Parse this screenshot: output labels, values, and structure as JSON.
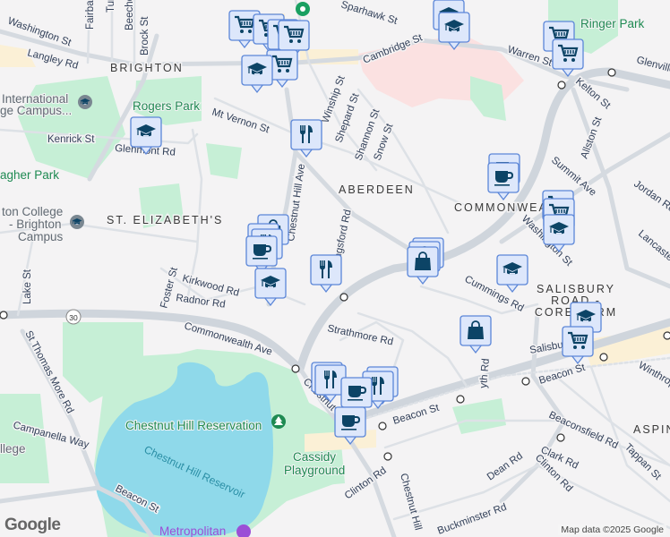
{
  "neighborhoods": {
    "brighton": "BRIGHTON",
    "aberdeen": "ABERDEEN",
    "st_elizabeths": "ST. ELIZABETH'S",
    "commonwealth": "COMMONWEA",
    "salisbury1": "SALISBURY",
    "salisbury2": "ROAD -",
    "salisbury3": "CORE FARM",
    "aspin": "ASPIN"
  },
  "parks": {
    "rogers": "Rogers Park",
    "ringer": "Ringer Park",
    "gallagher": "agher Park",
    "reservation": "Chestnut Hill Reservation",
    "cassidy1": "Cassidy",
    "cassidy2": "Playground",
    "reservoir": "Chestnut Hill Reservoir"
  },
  "pois": {
    "intl1": "International",
    "intl2": "ge Campus...",
    "bc1": "ton College",
    "bc2": "- Brighton",
    "bc3": "Campus",
    "college": "llege",
    "metropolitan": "Metropolitan"
  },
  "streets": {
    "washington": "Washington St",
    "langley": "Langley Rd",
    "fairbanks": "Fairban",
    "tur": "Tur",
    "beechcroft": "Beechc",
    "brock": "Brock St",
    "sparhawk": "Sparhawk St",
    "cambridge": "Cambridge St",
    "warren": "Warren St",
    "kelton": "Kelton St",
    "glenville": "Glenville",
    "mtvernon": "Mt Vernon St",
    "kenrick": "Kenrick St",
    "glenmont": "Glenmont Rd",
    "winship": "Winship St",
    "shepard": "Shepard St",
    "shannon": "Shannon St",
    "snow": "Snow St",
    "chestnut_hill_ave": "Chestnut Hill Ave",
    "allston": "Allston St",
    "summit": "Summit Ave",
    "jordan": "Jordan Rd",
    "lancaster": "Lancaster",
    "washington2": "Washington St",
    "kingsford": "Kingsford Rd",
    "kirkwood": "Kirkwood Rd",
    "radnor": "Radnor Rd",
    "foster": "Foster St",
    "lake": "Lake St",
    "commonwealth": "Commonwealth Ave",
    "st_thomas_more": "St Thomas More Rd",
    "campanella": "Campanella Way",
    "beacon1": "Beacon St",
    "beacon2": "Beacon St",
    "beacon3": "Beacon St",
    "cummings": "Cummings Rd",
    "strathmore": "Strathmore Rd",
    "ayth": "yth Rd",
    "salisbury": "Salisbu",
    "beaconsfield": "Beaconsfield Rd",
    "clark": "Clark Rd",
    "clinton1": "Clinton Rd",
    "clinton2": "Clinton Rd",
    "dean": "Dean Rd",
    "tappan": "Tappan St",
    "winthrop": "Winthrop",
    "buckminster": "Buckminster Rd",
    "chestnut_hill_ave2": "Chestnut Hill",
    "chestnut3": "Chestnut"
  },
  "route_shield": "30",
  "attribution": "Map data ©2025 Google",
  "logo": "Google",
  "marker_icons": [
    "grocery-cart",
    "graduation-cap",
    "fork-knife",
    "coffee-cup",
    "shopping-bag"
  ],
  "colors": {
    "marker_fill": "#dde7fb",
    "marker_border": "#5b86d8",
    "icon": "#0c4466",
    "park": "#c6efd6",
    "water": "#8fd9ea",
    "road": "#d5dae0",
    "background": "#f4f3f4",
    "campus": "#fbe1e1"
  }
}
